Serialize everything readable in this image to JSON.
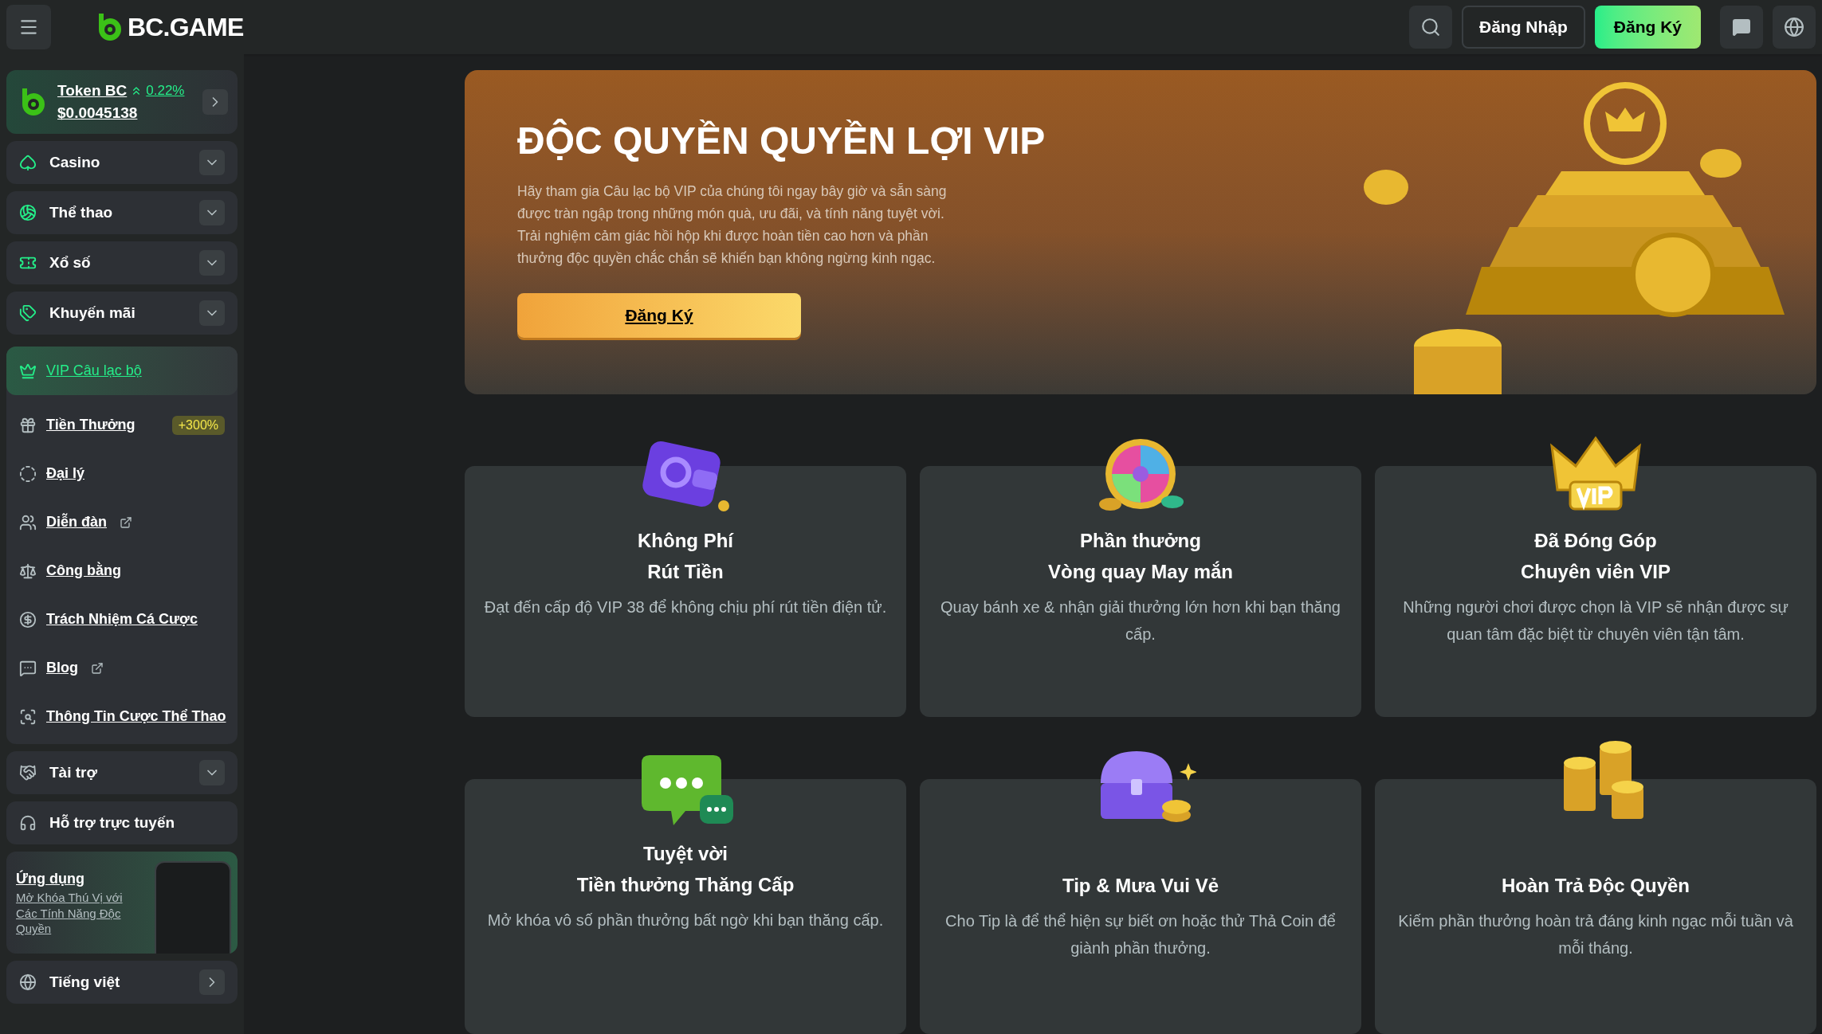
{
  "header": {
    "logo": "BC.GAME",
    "login": "Đăng Nhập",
    "signup": "Đăng Ký"
  },
  "token": {
    "name": "Token BC",
    "change": "0.22%",
    "price": "$0.0045138"
  },
  "categories": [
    {
      "label": "Casino",
      "kind": "dropdown"
    },
    {
      "label": "Thể thao",
      "kind": "dropdown"
    },
    {
      "label": "Xổ số",
      "kind": "dropdown"
    },
    {
      "label": "Khuyến mãi",
      "kind": "dropdown"
    }
  ],
  "links": [
    {
      "label": "VIP Câu lạc bộ",
      "selected": true,
      "external": false
    },
    {
      "label": "Tiền Thưởng",
      "selected": false,
      "external": false,
      "badge": "+300%"
    },
    {
      "label": "Đại lý",
      "selected": false,
      "external": false
    },
    {
      "label": "Diễn đàn",
      "selected": false,
      "external": true
    },
    {
      "label": "Công bằng",
      "selected": false,
      "external": false
    },
    {
      "label": "Trách Nhiệm Cá Cược",
      "selected": false,
      "external": false
    },
    {
      "label": "Blog",
      "selected": false,
      "external": true
    },
    {
      "label": "Thông Tin Cược Thể Thao",
      "selected": false,
      "external": false
    }
  ],
  "extras": [
    {
      "label": "Tài trợ",
      "kind": "dropdown"
    },
    {
      "label": "Hỗ trợ trực tuyến",
      "kind": "plain"
    }
  ],
  "app_promo": {
    "title": "Ứng dụng",
    "text": "Mở Khóa Thú Vị với Các Tính Năng Độc Quyền"
  },
  "language": {
    "label": "Tiếng việt"
  },
  "banner": {
    "title": "ĐỘC QUYỀN QUYỀN LỢI VIP",
    "text": "Hãy tham gia Câu lạc bộ VIP của chúng tôi ngay bây giờ và sẵn sàng được tràn ngập trong những món quà, ưu đãi, và tính năng tuyệt vời. Trải nghiệm cảm giác hồi hộp khi được hoàn tiền cao hơn và phần thưởng độc quyền chắc chắn sẽ khiến bạn không ngừng kinh ngạc.",
    "button": "Đăng Ký"
  },
  "features": [
    {
      "title": [
        "Không Phí",
        "Rút Tiền"
      ],
      "text": "Đạt đến cấp độ VIP 38 để không chịu phí rút tiền điện tử."
    },
    {
      "title": [
        "Phần thưởng",
        "Vòng quay May mắn"
      ],
      "text": "Quay bánh xe & nhận giải thưởng lớn hơn khi bạn thăng cấp."
    },
    {
      "title": [
        "Đã Đóng Góp",
        "Chuyên viên VIP"
      ],
      "text": "Những người chơi được chọn là VIP sẽ nhận được sự quan tâm đặc biệt từ chuyên viên tận tâm."
    },
    {
      "title": [
        "Tuyệt vời",
        "Tiền thưởng Thăng Cấp"
      ],
      "text": "Mở khóa vô số phần thưởng bất ngờ khi bạn thăng cấp."
    },
    {
      "title": [
        "Tip & Mưa Vui Vẻ"
      ],
      "text": "Cho Tip là để thể hiện sự biết ơn hoặc thử Thả Coin để giành phần thưởng."
    },
    {
      "title": [
        "Hoàn Trả Độc Quyền"
      ],
      "text": "Kiếm phần thưởng hoàn trả đáng kinh ngạc mỗi tuần và mỗi tháng."
    }
  ]
}
